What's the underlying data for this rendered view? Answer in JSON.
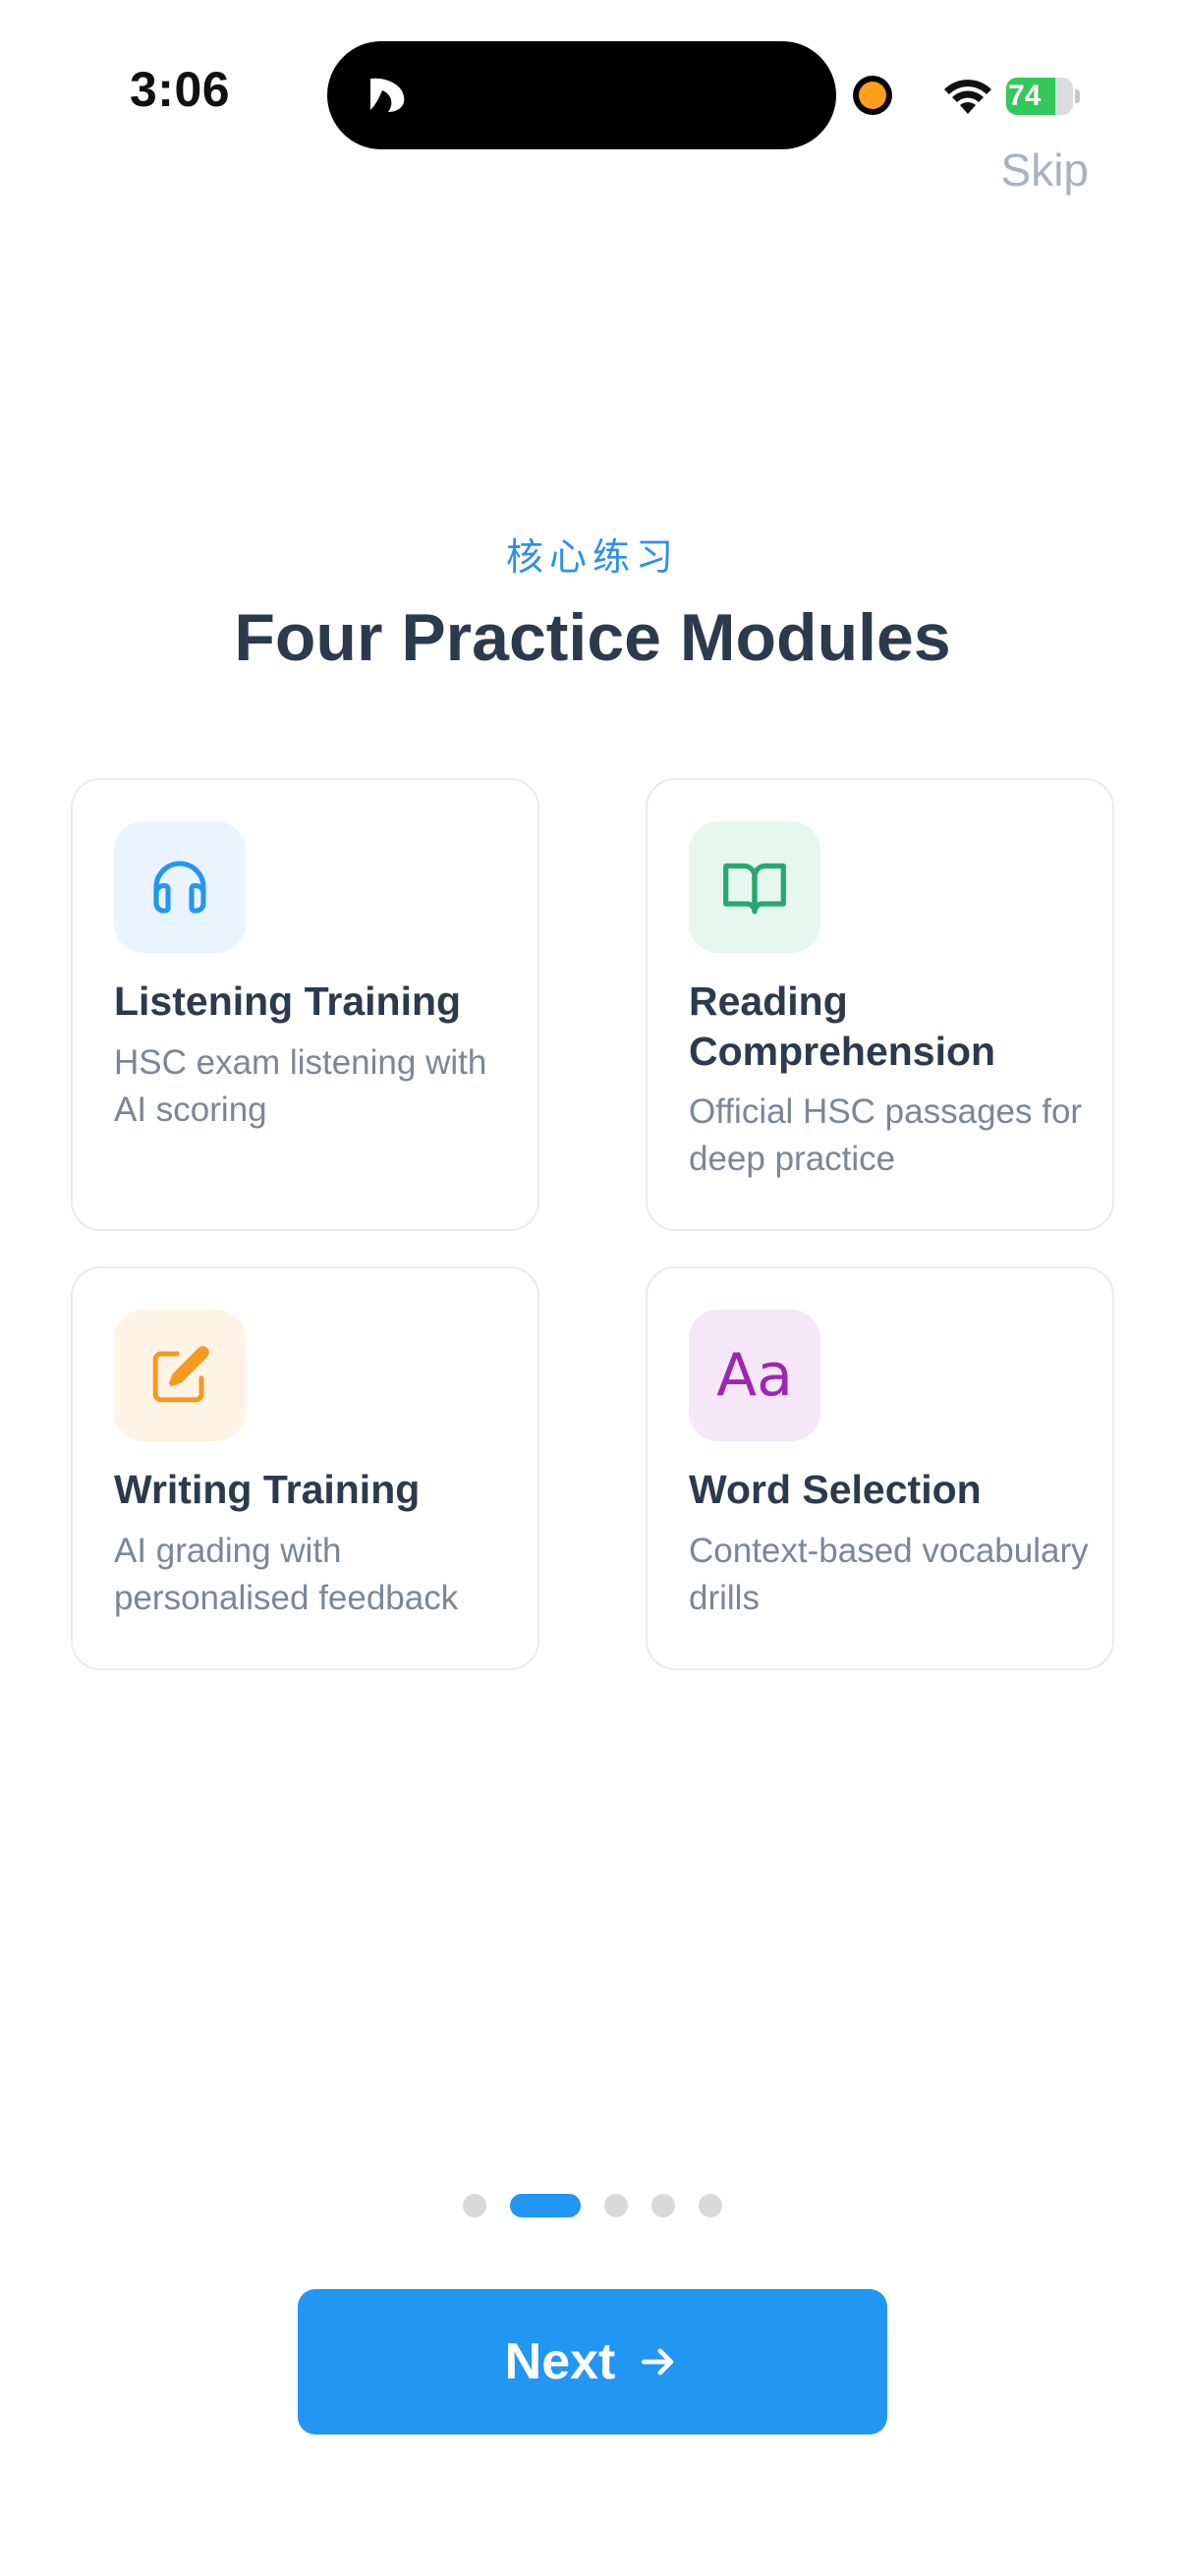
{
  "status_bar": {
    "time": "3:06",
    "battery_level": "74",
    "battery_fraction": 0.74,
    "battery_color": "#34c759",
    "recording_dot_color": "#ff9f1a"
  },
  "header": {
    "skip_label": "Skip",
    "eyebrow": "核心练习",
    "title": "Four Practice Modules"
  },
  "modules": [
    {
      "title": "Listening Training",
      "description": "HSC exam listening with AI scoring",
      "icon": "headphones-icon",
      "color": "#2196f3"
    },
    {
      "title": "Reading Comprehension",
      "description": "Official HSC passages for deep practice",
      "icon": "open-book-icon",
      "color": "#26a873"
    },
    {
      "title": "Writing Training",
      "description": "AI grading with personalised feedback",
      "icon": "edit-square-icon",
      "color": "#f59a1e"
    },
    {
      "title": "Word Selection",
      "description": "Context-based vocabulary drills",
      "icon": "text-format-icon",
      "icon_text": "Aa",
      "color": "#9c27b0"
    }
  ],
  "pagination": {
    "total": 5,
    "current": 2,
    "active_color": "#2196f3"
  },
  "next_button": {
    "label": "Next",
    "icon": "arrow-right-icon",
    "color": "#2196f3"
  }
}
